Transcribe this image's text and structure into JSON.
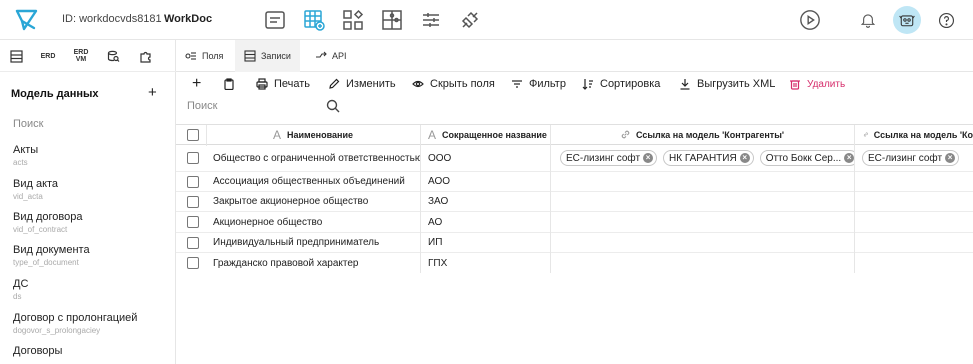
{
  "header": {
    "app_id": "ID: workdocvds8181",
    "app_name": "WorkDoc",
    "nav_icons": [
      "form-icon",
      "table-add-icon",
      "nodes-icon",
      "puzzle-icon",
      "sliders-icon",
      "plug-icon"
    ],
    "right_icons": [
      "play-icon",
      "bell-icon",
      "avatar-icon",
      "help-icon"
    ],
    "accent_color": "#2aa6d6"
  },
  "sidebar": {
    "tabs": [
      "table-icon",
      "ERD",
      "ERD\nVM",
      "search-db-icon",
      "puzzle-icon"
    ],
    "title": "Модель данных",
    "add_label": "+",
    "search_placeholder": "Поиск",
    "items": [
      {
        "label": "Акты",
        "sub": "acts"
      },
      {
        "label": "Вид акта",
        "sub": "vid_acta"
      },
      {
        "label": "Вид договора",
        "sub": "vid_of_contract"
      },
      {
        "label": "Вид документа",
        "sub": "type_of_document"
      },
      {
        "label": "ДС",
        "sub": "ds"
      },
      {
        "label": "Договор с пролонгацией",
        "sub": "dogovor_s_prolongaciey"
      },
      {
        "label": "Договоры",
        "sub": ""
      }
    ]
  },
  "tabs": [
    {
      "label": "Поля"
    },
    {
      "label": "Записи"
    },
    {
      "label": "API"
    }
  ],
  "toolbar": {
    "add": "+",
    "print": "Печать",
    "edit": "Изменить",
    "hide_fields": "Скрыть поля",
    "filter": "Фильтр",
    "sort": "Сортировка",
    "export_xml": "Выгрузить XML",
    "delete": "Удалить",
    "delete_color": "#d62d6b"
  },
  "search": {
    "placeholder": "Поиск"
  },
  "table": {
    "columns": [
      "Наименование",
      "Сокращенное название",
      "Ссылка на модель 'Контрагенты'",
      "Ссылка на модель 'Ко"
    ],
    "rows": [
      {
        "name": "Общество с ограниченной ответственностью",
        "short": "ООО",
        "links": [
          "ЕС-лизинг софт",
          "НК ГАРАНТИЯ",
          "Отто Бокк Сер..."
        ],
        "links2": [
          "ЕС-лизинг софт"
        ]
      },
      {
        "name": "Ассоциация общественных объединений",
        "short": "АОО",
        "links": [],
        "links2": []
      },
      {
        "name": "Закрытое акционерное общество",
        "short": "ЗАО",
        "links": [],
        "links2": []
      },
      {
        "name": "Акционерное общество",
        "short": "АО",
        "links": [],
        "links2": []
      },
      {
        "name": "Индивидуальный предприниматель",
        "short": "ИП",
        "links": [],
        "links2": []
      },
      {
        "name": "Гражданско правовой характер",
        "short": "ГПХ",
        "links": [],
        "links2": []
      }
    ]
  }
}
